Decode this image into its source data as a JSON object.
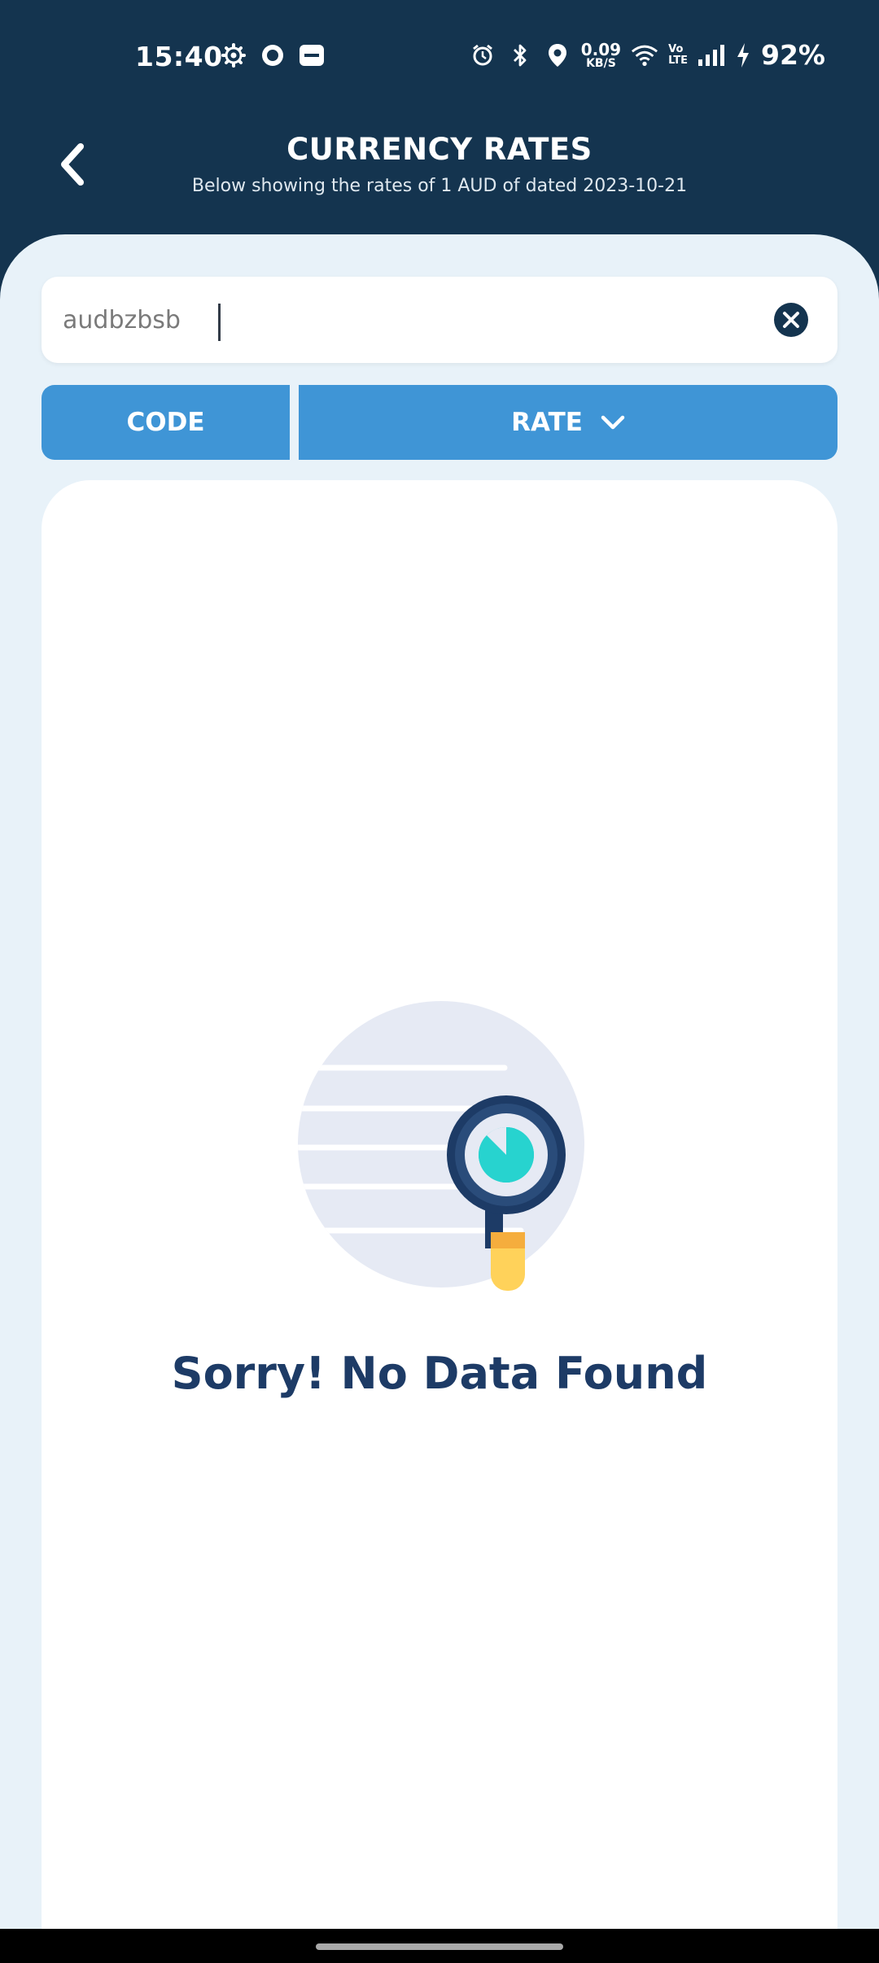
{
  "status_bar": {
    "time": "15:40",
    "net_speed_value": "0.09",
    "net_speed_unit": "KB/S",
    "volte_top": "Vo",
    "volte_bottom": "LTE",
    "battery": "92%",
    "left_icons": [
      "settings-gear-icon",
      "record-circle-icon",
      "paytm-icon"
    ],
    "right_icons": [
      "alarm-icon",
      "bluetooth-icon",
      "location-icon",
      "wifi-icon",
      "signal-icon",
      "charging-bolt-icon"
    ]
  },
  "header": {
    "title": "CURRENCY RATES",
    "subtitle": "Below showing the rates of 1 AUD of dated 2023-10-21",
    "background_color": "#14344f"
  },
  "search": {
    "value": "audbzbsb",
    "clear_icon": "close-circle-icon"
  },
  "columns": {
    "code_label": "CODE",
    "rate_label": "RATE",
    "rate_sort_icon": "chevron-down-icon",
    "header_color": "#3f95d6"
  },
  "empty_state": {
    "icon": "magnifier-no-data-illustration",
    "message": "Sorry! No Data Found",
    "message_color": "#1d3b66"
  }
}
